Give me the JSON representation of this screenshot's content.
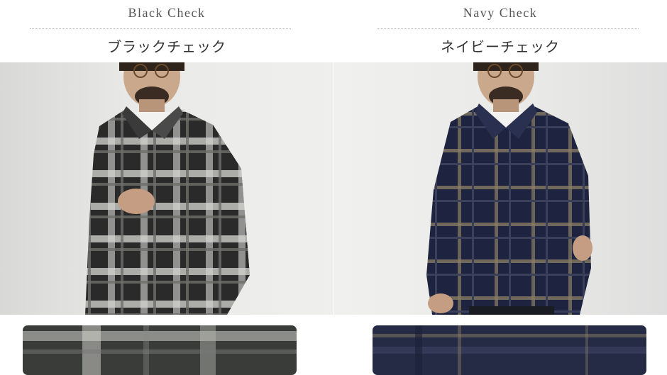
{
  "products": [
    {
      "name_en": "Black Check",
      "name_jp": "ブラックチェック",
      "colors": {
        "shirt_base": "#2a2a2a",
        "check_light": "#d6d6d2",
        "check_mid": "#6e6e6a",
        "swatch_base": "#3a3c3a"
      }
    },
    {
      "name_en": "Navy Check",
      "name_jp": "ネイビーチェック",
      "colors": {
        "shirt_base": "#1e2440",
        "check_light": "#8a7e66",
        "check_mid": "#3a3f5a",
        "swatch_base": "#252b45"
      }
    }
  ]
}
